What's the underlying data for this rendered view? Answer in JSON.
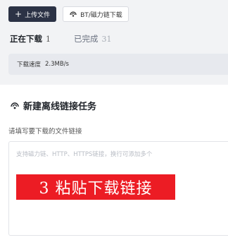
{
  "toolbar": {
    "upload_label": "上传文件",
    "magnet_label": "BT/磁力链下载"
  },
  "tabs": [
    {
      "label": "正在下载",
      "count": "1",
      "active": true
    },
    {
      "label": "已完成",
      "count": "31",
      "active": false
    }
  ],
  "speed": {
    "label": "下载速度",
    "value": "2.3MB/s"
  },
  "dialog": {
    "title": "新建离线链接任务",
    "instruction": "请填写要下载的文件链接",
    "placeholder": "支持磁力链、HTTP、HTTPS链接，换行可添加多个",
    "banner": "3 粘贴下载链接"
  },
  "colors": {
    "primary_button": "#2b3245",
    "banner": "#ec1c24"
  },
  "icons": {
    "upload": "plus-icon",
    "magnet": "magnet-icon",
    "dialog": "magnet-icon"
  }
}
